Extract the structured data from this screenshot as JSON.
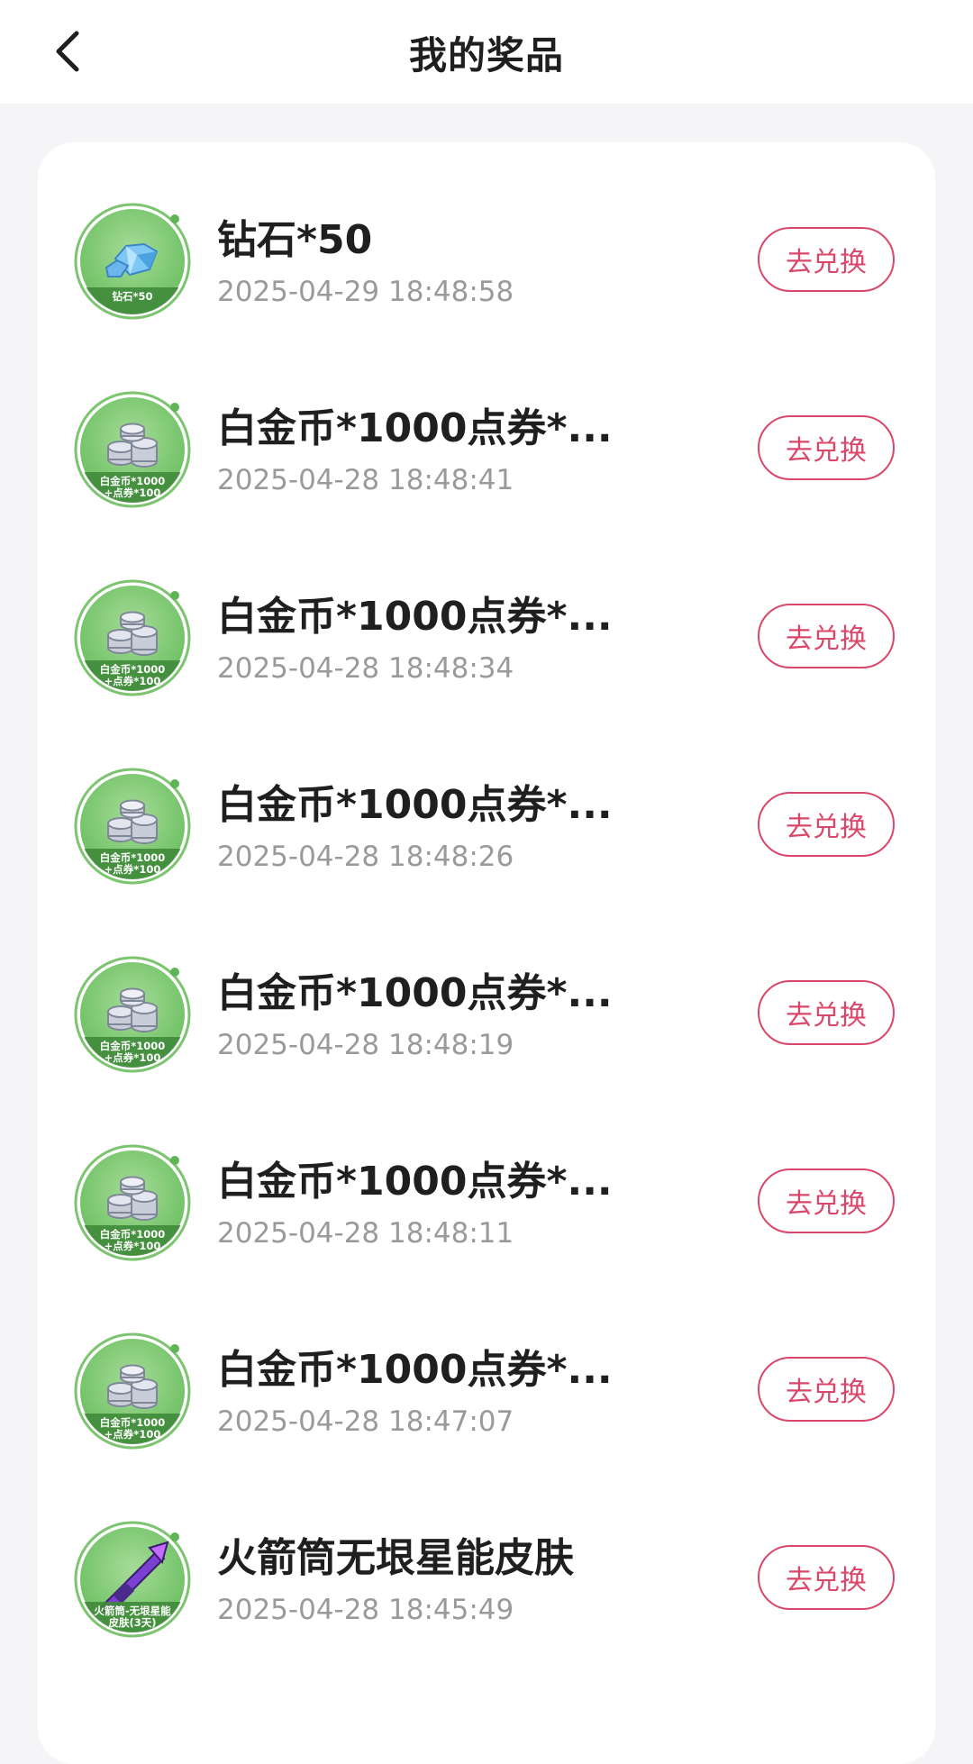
{
  "header": {
    "title": "我的奖品",
    "back_icon": "chevron-left-icon"
  },
  "colors": {
    "accent": "#d9476a",
    "thumb_green": "#86c97a",
    "thumb_green_dark": "#4e9c48",
    "page_bg": "#f5f5f7"
  },
  "prizes": [
    {
      "name": "钻石*50",
      "time": "2025-04-29 18:48:58",
      "button": "去兑换",
      "thumb_type": "diamond",
      "thumb_caption": [
        "钻石*50"
      ]
    },
    {
      "name": "白金币*1000点券*...",
      "time": "2025-04-28 18:48:41",
      "button": "去兑换",
      "thumb_type": "coins",
      "thumb_caption": [
        "白金币*1000",
        "+点券*100"
      ]
    },
    {
      "name": "白金币*1000点券*...",
      "time": "2025-04-28 18:48:34",
      "button": "去兑换",
      "thumb_type": "coins",
      "thumb_caption": [
        "白金币*1000",
        "+点券*100"
      ]
    },
    {
      "name": "白金币*1000点券*...",
      "time": "2025-04-28 18:48:26",
      "button": "去兑换",
      "thumb_type": "coins",
      "thumb_caption": [
        "白金币*1000",
        "+点券*100"
      ]
    },
    {
      "name": "白金币*1000点券*...",
      "time": "2025-04-28 18:48:19",
      "button": "去兑换",
      "thumb_type": "coins",
      "thumb_caption": [
        "白金币*1000",
        "+点券*100"
      ]
    },
    {
      "name": "白金币*1000点券*...",
      "time": "2025-04-28 18:48:11",
      "button": "去兑换",
      "thumb_type": "coins",
      "thumb_caption": [
        "白金币*1000",
        "+点券*100"
      ]
    },
    {
      "name": "白金币*1000点券*...",
      "time": "2025-04-28 18:47:07",
      "button": "去兑换",
      "thumb_type": "coins",
      "thumb_caption": [
        "白金币*1000",
        "+点券*100"
      ]
    },
    {
      "name": "火箭筒无垠星能皮肤",
      "time": "2025-04-28 18:45:49",
      "button": "去兑换",
      "thumb_type": "rocket",
      "thumb_caption": [
        "火箭筒-无垠星能",
        "皮肤(3天)"
      ]
    }
  ]
}
